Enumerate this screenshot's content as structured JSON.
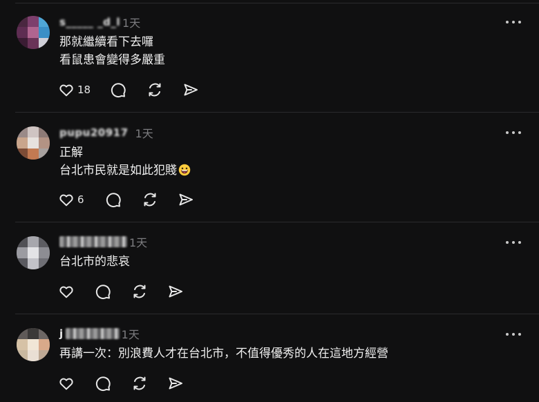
{
  "posts": [
    {
      "username": "s_____ _d_l",
      "time": "1天",
      "lines": [
        "那就繼續看下去囉",
        "看鼠患會變得多嚴重"
      ],
      "likes": "18"
    },
    {
      "username": "pupu20917",
      "time": "1天",
      "lines": [
        "正解",
        "台北市民就是如此犯賤"
      ],
      "emoji": "grinning-face-emoji",
      "likes": "6"
    },
    {
      "username": "",
      "time": "1天",
      "lines": [
        "台北市的悲哀"
      ],
      "likes": ""
    },
    {
      "username": "j",
      "time": "1天",
      "lines": [
        "再講一次：別浪費人才在台北市，不值得優秀的人在這地方經營"
      ],
      "likes": ""
    }
  ],
  "icons": {
    "like": "heart-icon",
    "reply": "comment-bubble-icon",
    "repost": "repost-icon",
    "share": "send-icon",
    "more": "more-options-icon"
  },
  "colors": {
    "background": "#101011",
    "text": "#f0f0f0",
    "muted": "#7c7c7f",
    "divider": "#2b2b2d"
  }
}
